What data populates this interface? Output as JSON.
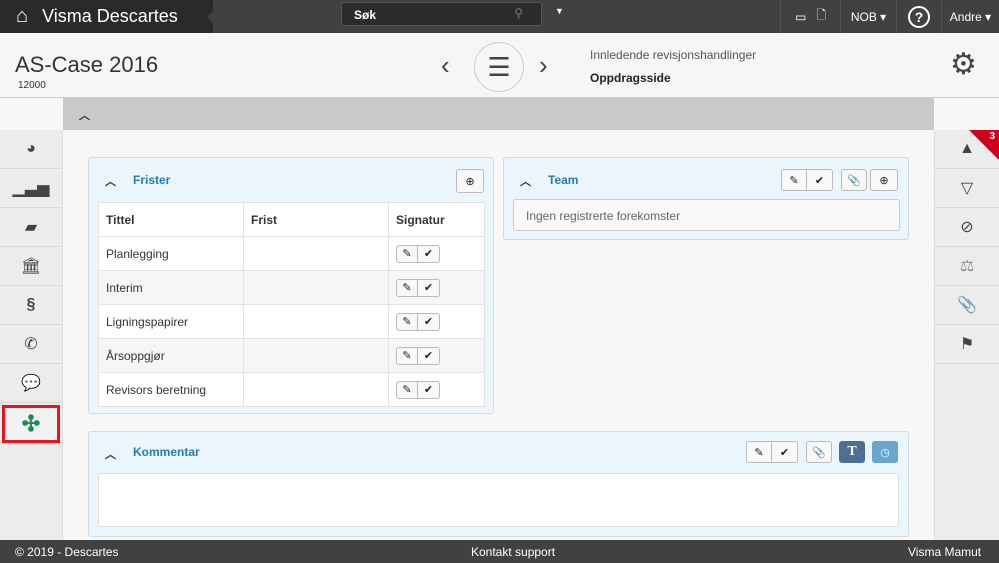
{
  "topbar": {
    "app_name": "Visma Descartes",
    "search_placeholder": "Søk",
    "language": "NOB",
    "user": "Andre"
  },
  "header": {
    "case_title": "AS-Case 2016",
    "case_number": "12000",
    "section": "Innledende revisjonshandlinger",
    "page": "Oppdragsside"
  },
  "right_sidebar": {
    "warning_count": "3"
  },
  "frister": {
    "title": "Frister",
    "columns": [
      "Tittel",
      "Frist",
      "Signatur"
    ],
    "rows": [
      {
        "tittel": "Planlegging",
        "frist": ""
      },
      {
        "tittel": "Interim",
        "frist": ""
      },
      {
        "tittel": "Ligningspapirer",
        "frist": ""
      },
      {
        "tittel": "Årsoppgjør",
        "frist": ""
      },
      {
        "tittel": "Revisors beretning",
        "frist": ""
      }
    ]
  },
  "team": {
    "title": "Team",
    "empty_text": "Ingen registrerte forekomster"
  },
  "kommentar": {
    "title": "Kommentar",
    "text_button": "T"
  },
  "footer": {
    "copyright": "© 2019 - Descartes",
    "support": "Kontakt support",
    "company": "Visma Mamut"
  },
  "colors": {
    "topbar": "#404143",
    "accent": "#2a7ab0",
    "badge": "#d0021b",
    "highlight": "#e8141c"
  }
}
